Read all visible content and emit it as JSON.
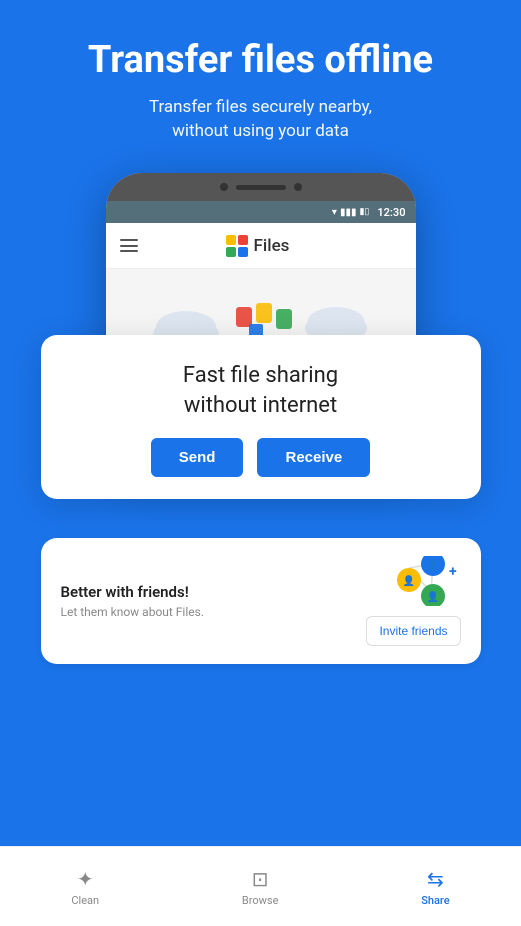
{
  "header": {
    "title": "Transfer files offline",
    "subtitle": "Transfer files securely nearby,\nwithout using your data"
  },
  "phone": {
    "status_time": "12:30",
    "app_name": "Files"
  },
  "sharing_card": {
    "title": "Fast file sharing\nwithout internet",
    "send_label": "Send",
    "receive_label": "Receive"
  },
  "friends_card": {
    "title": "Better with friends!",
    "subtitle": "Let them know about Files.",
    "invite_label": "Invite friends"
  },
  "nav": {
    "items": [
      {
        "label": "Clean",
        "active": false
      },
      {
        "label": "Browse",
        "active": false
      },
      {
        "label": "Share",
        "active": true
      }
    ]
  }
}
